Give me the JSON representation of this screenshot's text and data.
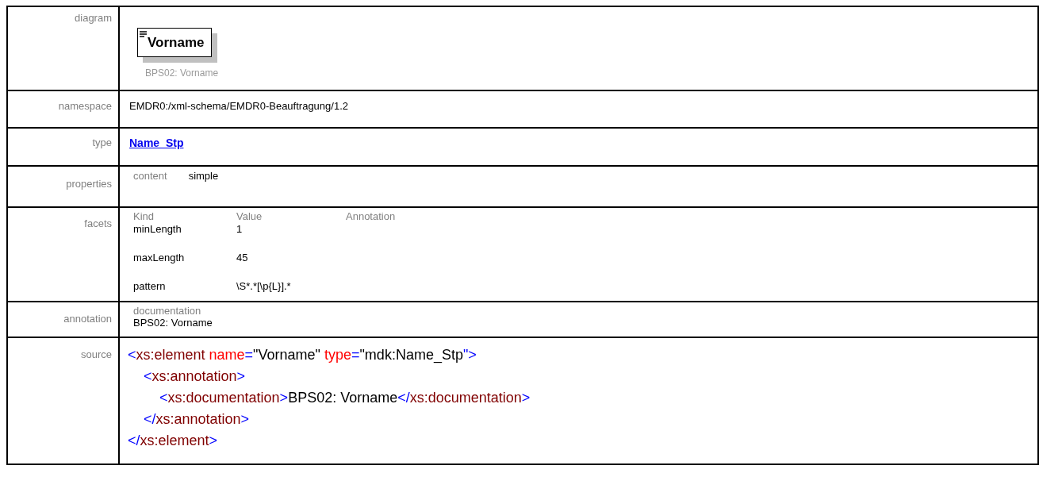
{
  "diagram": {
    "label": "diagram",
    "element_name": "Vorname",
    "element_doc": "BPS02: Vorname"
  },
  "namespace": {
    "label": "namespace",
    "value": "EMDR0:/xml-schema/EMDR0-Beauftragung/1.2"
  },
  "type": {
    "label": "type",
    "value": "Name_Stp"
  },
  "properties": {
    "label": "properties",
    "items": [
      {
        "key": "content",
        "value": "simple"
      }
    ]
  },
  "facets": {
    "label": "facets",
    "columns": [
      "Kind",
      "Value",
      "Annotation"
    ],
    "rows": [
      {
        "kind": "minLength",
        "value": "1"
      },
      {
        "kind": "maxLength",
        "value": "45"
      },
      {
        "kind": "pattern",
        "value": "\\S*.*[\\p{L}].*"
      }
    ]
  },
  "annotation": {
    "label": "annotation",
    "heading": "documentation",
    "text": "BPS02: Vorname"
  },
  "source": {
    "label": "source",
    "lines": [
      {
        "tokens": [
          {
            "kind": "punct",
            "text": "<"
          },
          {
            "kind": "tag",
            "text": "xs:element"
          },
          {
            "kind": "attr",
            "text": " name"
          },
          {
            "kind": "punct",
            "text": "="
          },
          {
            "kind": "text",
            "text": "\"Vorname\" "
          },
          {
            "kind": "attr",
            "text": "type"
          },
          {
            "kind": "punct",
            "text": "="
          },
          {
            "kind": "text",
            "text": "\"mdk:Name_Stp"
          },
          {
            "kind": "punct",
            "text": "\">"
          }
        ],
        "children": [
          {
            "tokens": [
              {
                "kind": "punct",
                "text": "<"
              },
              {
                "kind": "tag",
                "text": "xs:annotation"
              },
              {
                "kind": "punct",
                "text": ">"
              }
            ],
            "children": [
              {
                "tokens": [
                  {
                    "kind": "punct",
                    "text": "<"
                  },
                  {
                    "kind": "tag",
                    "text": "xs:documentation"
                  },
                  {
                    "kind": "punct",
                    "text": ">"
                  },
                  {
                    "kind": "text",
                    "text": "BPS02: Vorname"
                  },
                  {
                    "kind": "punct",
                    "text": "</"
                  },
                  {
                    "kind": "tag",
                    "text": "xs:documentation"
                  },
                  {
                    "kind": "punct",
                    "text": ">"
                  }
                ]
              }
            ]
          },
          {
            "tokens": [
              {
                "kind": "punct",
                "text": "</"
              },
              {
                "kind": "tag",
                "text": "xs:annotation"
              },
              {
                "kind": "punct",
                "text": ">"
              }
            ]
          }
        ]
      },
      {
        "tokens": [
          {
            "kind": "punct",
            "text": "</"
          },
          {
            "kind": "tag",
            "text": "xs:element"
          },
          {
            "kind": "punct",
            "text": ">"
          }
        ]
      }
    ]
  }
}
